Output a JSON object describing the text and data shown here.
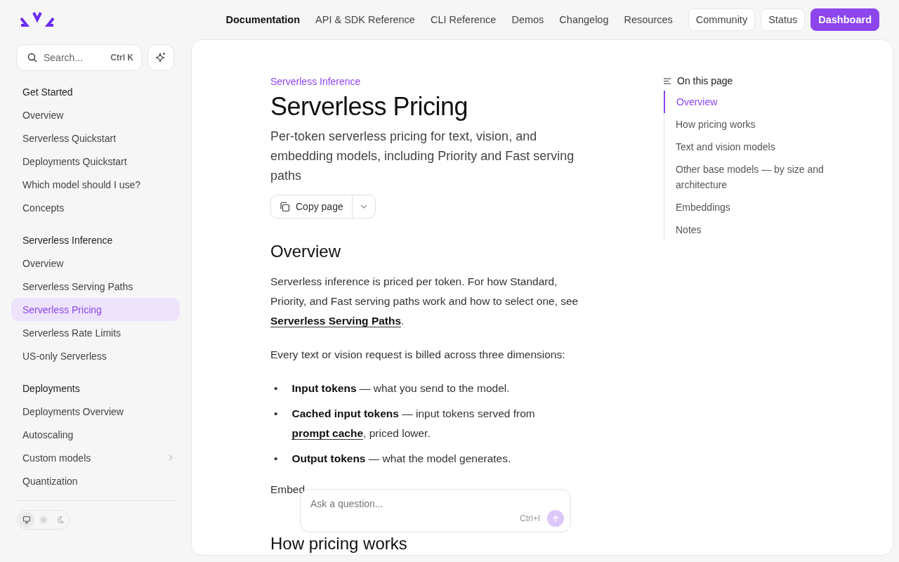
{
  "header": {
    "nav_links": [
      {
        "label": "Documentation",
        "selected": true
      },
      {
        "label": "API & SDK Reference",
        "selected": false
      },
      {
        "label": "CLI Reference",
        "selected": false
      },
      {
        "label": "Demos",
        "selected": false
      },
      {
        "label": "Changelog",
        "selected": false
      },
      {
        "label": "Resources",
        "selected": false
      }
    ],
    "buttons": [
      {
        "label": "Community",
        "kind": "outline"
      },
      {
        "label": "Status",
        "kind": "outline"
      },
      {
        "label": "Dashboard",
        "kind": "primary"
      }
    ]
  },
  "sidebar": {
    "search": {
      "placeholder": "Search...",
      "shortcut": "Ctrl K"
    },
    "groups": [
      {
        "title": "Get Started",
        "items": [
          {
            "label": "Overview",
            "selected": false,
            "expandable": false
          },
          {
            "label": "Serverless Quickstart",
            "selected": false,
            "expandable": false
          },
          {
            "label": "Deployments Quickstart",
            "selected": false,
            "expandable": false
          },
          {
            "label": "Which model should I use?",
            "selected": false,
            "expandable": false
          },
          {
            "label": "Concepts",
            "selected": false,
            "expandable": false
          }
        ]
      },
      {
        "title": "Serverless Inference",
        "items": [
          {
            "label": "Overview",
            "selected": false,
            "expandable": false
          },
          {
            "label": "Serverless Serving Paths",
            "selected": false,
            "expandable": false
          },
          {
            "label": "Serverless Pricing",
            "selected": true,
            "expandable": false
          },
          {
            "label": "Serverless Rate Limits",
            "selected": false,
            "expandable": false
          },
          {
            "label": "US-only Serverless",
            "selected": false,
            "expandable": false
          }
        ]
      },
      {
        "title": "Deployments",
        "items": [
          {
            "label": "Deployments Overview",
            "selected": false,
            "expandable": false
          },
          {
            "label": "Autoscaling",
            "selected": false,
            "expandable": false
          },
          {
            "label": "Custom models",
            "selected": false,
            "expandable": true
          },
          {
            "label": "Quantization",
            "selected": false,
            "expandable": false
          }
        ]
      }
    ],
    "theme_options": [
      {
        "kind": "system",
        "selected": true
      },
      {
        "kind": "light",
        "selected": false
      },
      {
        "kind": "dark",
        "selected": false
      }
    ]
  },
  "article": {
    "eyebrow": "Serverless Inference",
    "title": "Serverless Pricing",
    "description": "Per-token serverless pricing for text, vision, and embedding models, including Priority and Fast serving paths",
    "copy_button": "Copy page",
    "blocks": [
      {
        "kind": "heading",
        "text": "Overview"
      },
      {
        "kind": "paragraph",
        "parts": [
          {
            "kind": "text",
            "text": "Serverless inference is priced per token. For how Standard, Priority, and Fast serving paths work and how to select one, see "
          },
          {
            "kind": "link",
            "text": "Serverless Serving Paths"
          },
          {
            "kind": "text",
            "text": "."
          }
        ]
      },
      {
        "kind": "paragraph",
        "parts": [
          {
            "kind": "text",
            "text": "Every text or vision request is billed across three dimensions:"
          }
        ]
      },
      {
        "kind": "bullets",
        "marker": "•",
        "items": [
          [
            {
              "kind": "bold",
              "text": "Input tokens"
            },
            {
              "kind": "text",
              "text": " — what you send to the model."
            }
          ],
          [
            {
              "kind": "bold",
              "text": "Cached input tokens"
            },
            {
              "kind": "text",
              "text": " — input tokens served from "
            },
            {
              "kind": "link",
              "text": "prompt cache"
            },
            {
              "kind": "text",
              "text": ", priced lower."
            }
          ],
          [
            {
              "kind": "bold",
              "text": "Output tokens"
            },
            {
              "kind": "text",
              "text": " — what the model generates."
            }
          ]
        ]
      },
      {
        "kind": "paragraph",
        "parts": [
          {
            "kind": "text",
            "text": "Embed"
          }
        ]
      },
      {
        "kind": "heading",
        "text": "How pricing works"
      }
    ]
  },
  "toc": {
    "title": "On this page",
    "items": [
      {
        "label": "Overview",
        "selected": true
      },
      {
        "label": "How pricing works",
        "selected": false
      },
      {
        "label": "Text and vision models",
        "selected": false
      },
      {
        "label": "Other base models — by size and architecture",
        "selected": false
      },
      {
        "label": "Embeddings",
        "selected": false
      },
      {
        "label": "Notes",
        "selected": false
      }
    ]
  },
  "assistant": {
    "placeholder": "Ask a question...",
    "shortcut": "Ctrl+I"
  }
}
